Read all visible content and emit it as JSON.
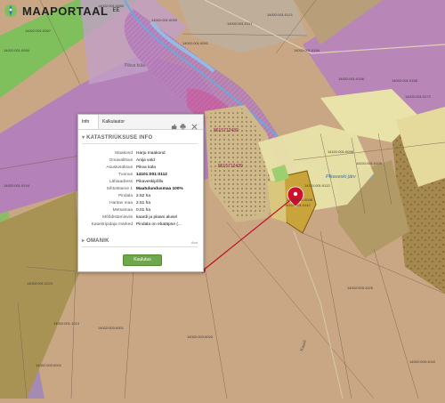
{
  "app": {
    "title": "MAAPORTAAL",
    "sup": "EE"
  },
  "popup": {
    "tabs": [
      {
        "label": "Info"
      },
      {
        "label": "Kalkulaator"
      }
    ],
    "section_title": "KATASTRIÜKSUSE INFO",
    "rows": [
      {
        "label": "Maakond",
        "value": "Harju maakond"
      },
      {
        "label": "Omavalitsus",
        "value": "Anija vald"
      },
      {
        "label": "Asustusüksus",
        "value": "Pikva küla"
      },
      {
        "label": "Tunnus",
        "value": "14101:001:0112"
      },
      {
        "label": "Lähiaadress",
        "value": "Pikaveskipõllu"
      },
      {
        "label": "Sihtotstarve 1",
        "value": "Maatulundusmaa 100%"
      },
      {
        "label": "Pindala",
        "value": "2.52 ha"
      },
      {
        "label": "Haritav maa",
        "value": "2.51 ha"
      },
      {
        "label": "Metsamaa",
        "value": "0.01 ha"
      },
      {
        "label": "Mõõdistamisviis",
        "value": "kaardi ja plaani alusel"
      },
      {
        "label": "Katastripidaja märked",
        "value": "Pindala on ebatäpne (..."
      }
    ],
    "section2_title": "OMANIK",
    "button_label": "Kuulutus",
    "aux_text": "Ava"
  },
  "map": {
    "parcel_ids": [
      "14101:001:0098",
      "14101:001:0113",
      "14101:001:0112",
      "14101:001:0096",
      "14101:001:0109",
      "14002:001:0065",
      "14002:001:0067",
      "14002:001:0080",
      "14002:001:0090",
      "14002:001:0091",
      "14002:001:0117",
      "14002:001:0121",
      "14002:001:0154",
      "14002:001:0156",
      "14002:001:0158",
      "14002:001:0172",
      "14002:001:0194",
      "14002:001:0223",
      "14002:001:1013",
      "14002:003:0001",
      "14002:003:0020",
      "14002:003:1026",
      "14002:003:0002",
      "14002:003:1040"
    ],
    "place_names": [
      "Pikaveski järv",
      "Pikva küla",
      "Kaarli"
    ],
    "point_labels": [
      "8615712439",
      "8615712439"
    ],
    "colors": {
      "agricultural": "#c9a784",
      "forest": "#b89d62",
      "residential": "#e8e2a8",
      "natural": "#9a8f5a",
      "selected": "#c9a43a",
      "protected": "#b27fb0",
      "highlight": "#d44a8a",
      "marker": "#d0102a",
      "green": "#7fc05c"
    }
  }
}
